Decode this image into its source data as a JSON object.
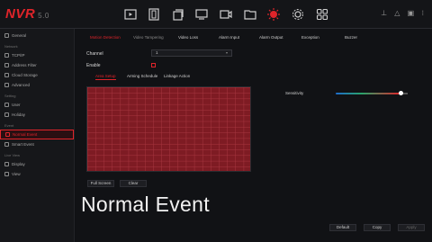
{
  "app": {
    "logo": "NVR",
    "version": "5.0"
  },
  "topbar": {
    "icons": [
      "playback-icon",
      "film-icon",
      "copy-icon",
      "monitor-icon",
      "camera-icon",
      "folder-icon",
      "alarm-icon",
      "settings-icon",
      "grid-icon"
    ],
    "right": "⊥ △ ▣ ⁝"
  },
  "sidebar": {
    "top_items": [
      {
        "label": "General"
      }
    ],
    "network_section": "Network",
    "network_items": [
      {
        "label": "TCP/IP"
      },
      {
        "label": "Address Filter"
      },
      {
        "label": "Cloud Storage"
      },
      {
        "label": "Advanced"
      }
    ],
    "setting_section": "Setting",
    "setting_items": [
      {
        "label": "User"
      },
      {
        "label": "Holiday"
      }
    ],
    "event_section": "Event",
    "event_items": [
      {
        "label": "Normal Event"
      },
      {
        "label": "Smart Event"
      }
    ],
    "liveview_section": "Live View",
    "liveview_items": [
      {
        "label": "Display"
      },
      {
        "label": "View"
      }
    ]
  },
  "tabs": [
    "Motion Detection",
    "Video Tampering",
    "Video Loss",
    "Alarm Input",
    "Alarm Output",
    "Exception",
    "Buzzer"
  ],
  "form": {
    "channel_label": "Channel",
    "channel_value": "1",
    "enable_label": "Enable"
  },
  "subtabs": [
    "Area Setup",
    "Arming Schedule",
    "Linkage Action"
  ],
  "sensitivity_label": "Sensitivity",
  "sensitivity_value": 0.9,
  "buttons": {
    "full_screen": "Full Screen",
    "clear": "Clear",
    "default": "Default",
    "copy": "Copy",
    "apply": "Apply"
  },
  "caption": "Normal Event",
  "colors": {
    "accent": "#e0242a",
    "grid": "#7e1b23"
  }
}
